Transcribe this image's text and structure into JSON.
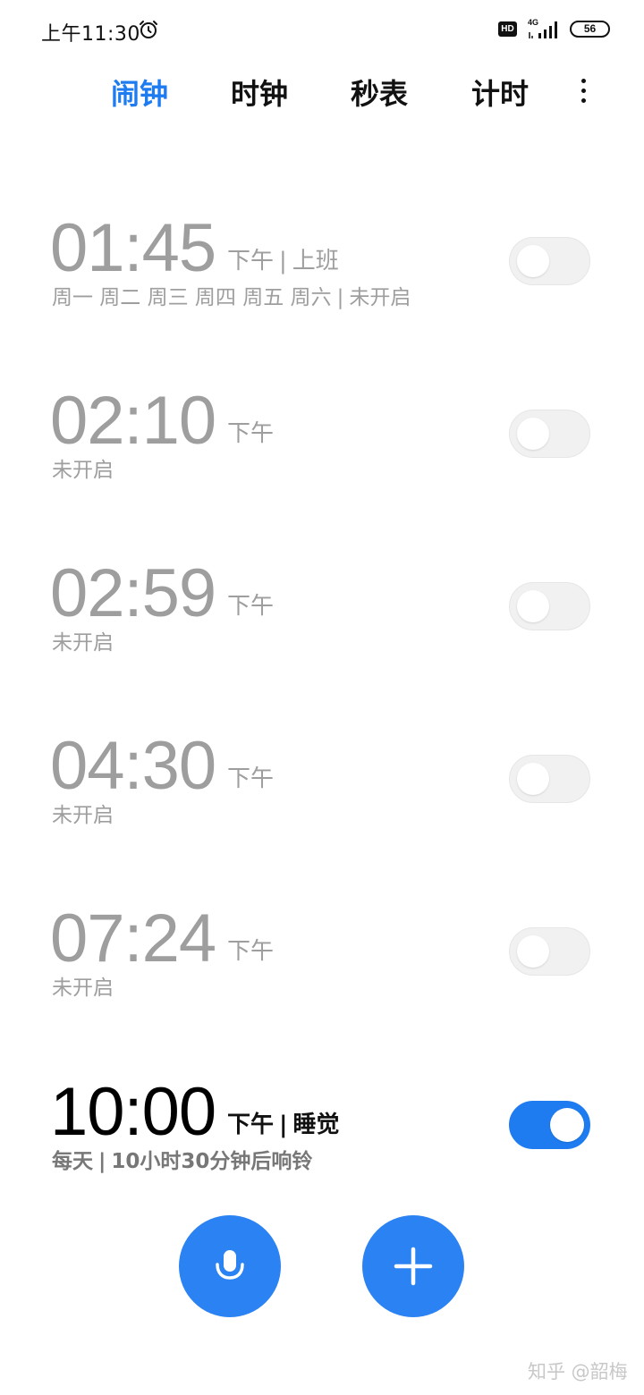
{
  "status_bar": {
    "time": "上午11:30",
    "alarm_icon": "alarm-clock-icon",
    "hd": "HD",
    "network": "4G",
    "battery": "56"
  },
  "tabs": [
    {
      "label": "闹钟",
      "active": true
    },
    {
      "label": "时钟",
      "active": false
    },
    {
      "label": "秒表",
      "active": false
    },
    {
      "label": "计时",
      "active": false
    }
  ],
  "more_icon": "more-vertical-icon",
  "alarms": [
    {
      "time": "01:45",
      "ampm": "下午",
      "name": "上班",
      "sub": "周一 周二 周三 周四 周五 周六",
      "status": "未开启",
      "enabled": false
    },
    {
      "time": "02:10",
      "ampm": "下午",
      "name": "",
      "sub": "",
      "status": "未开启",
      "enabled": false
    },
    {
      "time": "02:59",
      "ampm": "下午",
      "name": "",
      "sub": "",
      "status": "未开启",
      "enabled": false
    },
    {
      "time": "04:30",
      "ampm": "下午",
      "name": "",
      "sub": "",
      "status": "未开启",
      "enabled": false
    },
    {
      "time": "07:24",
      "ampm": "下午",
      "name": "",
      "sub": "",
      "status": "未开启",
      "enabled": false
    },
    {
      "time": "10:00",
      "ampm": "下午",
      "name": "睡觉",
      "sub": "每天",
      "status": "10小时30分钟后响铃",
      "enabled": true
    }
  ],
  "fabs": {
    "voice_icon": "microphone-icon",
    "add_icon": "plus-icon"
  },
  "colors": {
    "accent": "#1e7cf0",
    "disabled_text": "#9e9e9e"
  },
  "watermark": "知乎 @韶梅"
}
